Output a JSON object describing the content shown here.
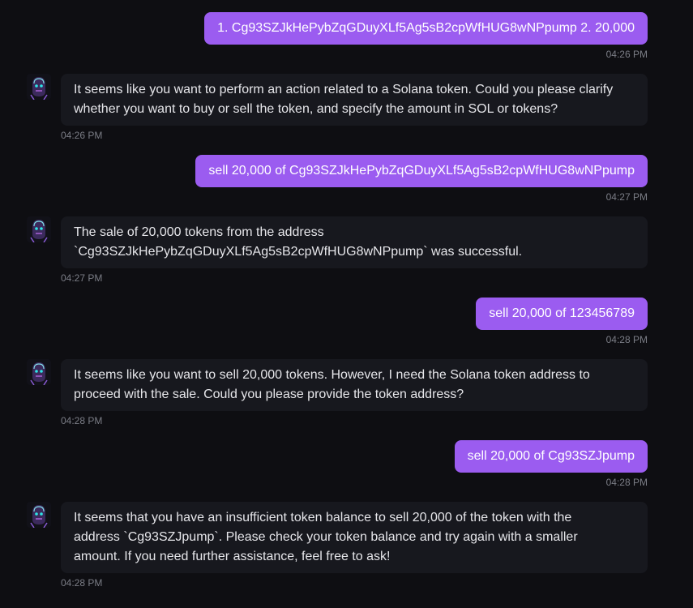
{
  "messages": [
    {
      "role": "user",
      "text": "1. Cg93SZJkHePybZqGDuyXLf5Ag5sB2cpWfHUG8wNPpump 2. 20,000",
      "time": "04:26 PM"
    },
    {
      "role": "assistant",
      "lines": [
        "It seems like you want to perform an action related to a Solana token. Could you please clarify",
        "whether you want to buy or sell the token, and specify the amount in SOL or tokens?"
      ],
      "time": "04:26 PM"
    },
    {
      "role": "user",
      "text": "sell 20,000 of Cg93SZJkHePybZqGDuyXLf5Ag5sB2cpWfHUG8wNPpump",
      "time": "04:27 PM"
    },
    {
      "role": "assistant",
      "lines": [
        "The sale of 20,000 tokens from the address",
        "`Cg93SZJkHePybZqGDuyXLf5Ag5sB2cpWfHUG8wNPpump` was successful."
      ],
      "time": "04:27 PM"
    },
    {
      "role": "user",
      "text": "sell 20,000 of 123456789",
      "time": "04:28 PM"
    },
    {
      "role": "assistant",
      "lines": [
        "It seems like you want to sell 20,000 tokens. However, I need the Solana token address to",
        "proceed with the sale. Could you please provide the token address?"
      ],
      "time": "04:28 PM"
    },
    {
      "role": "user",
      "text": "sell 20,000 of Cg93SZJpump",
      "time": "04:28 PM"
    },
    {
      "role": "assistant",
      "lines": [
        "It seems that you have an insufficient token balance to sell 20,000 of the token with the",
        "address `Cg93SZJpump`. Please check your token balance and try again with a smaller",
        "amount. If you need further assistance, feel free to ask!"
      ],
      "time": "04:28 PM"
    }
  ],
  "colors": {
    "user_bubble": "#9b5cf0",
    "bot_bubble": "#17181e",
    "background": "#0e0e12",
    "timestamp": "#7b7d86"
  },
  "icons": {
    "assistant_avatar": "robot-avatar-icon"
  }
}
